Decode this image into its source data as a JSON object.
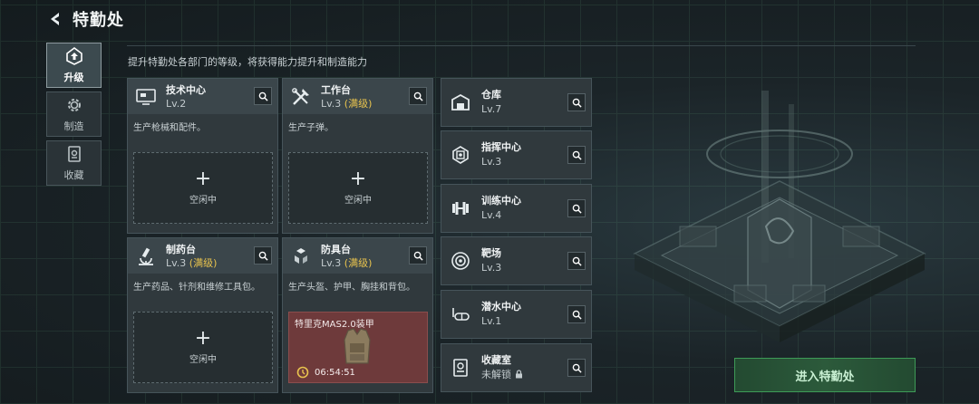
{
  "header": {
    "title": "特勤处"
  },
  "description": "提升特勤处各部门的等级，将获得能力提升和制造能力",
  "tabs": [
    {
      "label": "升级",
      "icon": "upgrade-icon",
      "active": true
    },
    {
      "label": "制造",
      "icon": "gear-icon",
      "active": false
    },
    {
      "label": "收藏",
      "icon": "collection-icon",
      "active": false
    }
  ],
  "cards": [
    {
      "name": "技术中心",
      "level": "Lv.2",
      "maxed": "",
      "desc": "生产枪械和配件。",
      "slot_label": "空闲中",
      "slot_plus": "+"
    },
    {
      "name": "工作台",
      "level": "Lv.3",
      "maxed": "(满级)",
      "desc": "生产子弹。",
      "slot_label": "空闲中",
      "slot_plus": "+"
    },
    {
      "name": "制药台",
      "level": "Lv.3",
      "maxed": "(满级)",
      "desc": "生产药品、针剂和维修工具包。",
      "slot_label": "空闲中",
      "slot_plus": "+"
    },
    {
      "name": "防具台",
      "level": "Lv.3",
      "maxed": "(满级)",
      "desc": "生产头盔、护甲、胸挂和背包。",
      "production": {
        "item": "特里克MAS2.0装甲",
        "timer": "06:54:51"
      }
    }
  ],
  "small_cards": [
    {
      "name": "仓库",
      "level": "Lv.7",
      "icon": "warehouse-icon"
    },
    {
      "name": "指挥中心",
      "level": "Lv.3",
      "icon": "command-chip-icon"
    },
    {
      "name": "训练中心",
      "level": "Lv.4",
      "icon": "dumbbell-icon"
    },
    {
      "name": "靶场",
      "level": "Lv.3",
      "icon": "target-icon"
    },
    {
      "name": "潜水中心",
      "level": "Lv.1",
      "icon": "diving-mask-icon"
    },
    {
      "name": "收藏室",
      "level": "未解锁",
      "icon": "vault-icon"
    }
  ],
  "enter_button": "进入特勤处",
  "colors": {
    "accent_green": "#3e9b57",
    "maxed_yellow": "#e8c34e",
    "production_red": "#6e3a3b"
  }
}
